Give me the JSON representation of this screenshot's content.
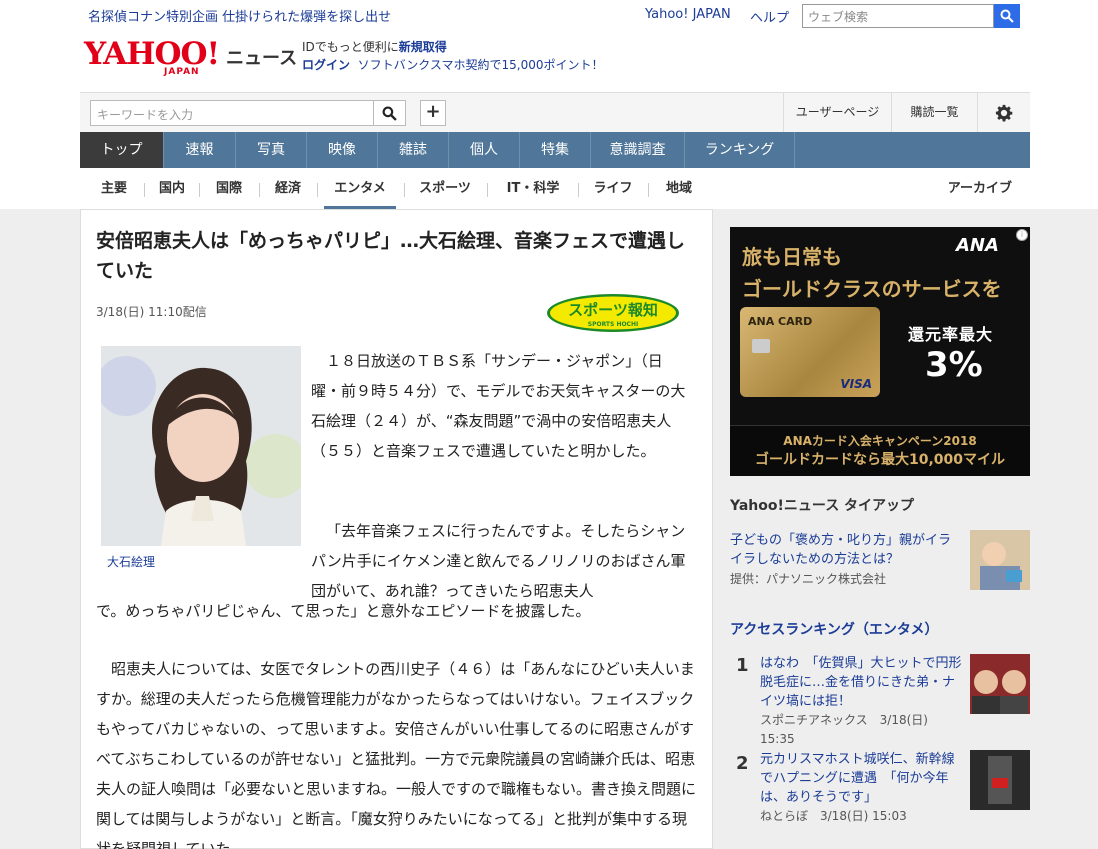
{
  "top": {
    "promo": "名探偵コナン特別企画 仕掛けられた爆弾を探し出せ",
    "yahoo_japan": "Yahoo! JAPAN",
    "help": "ヘルプ",
    "websearch_placeholder": "ウェブ検索"
  },
  "brand": {
    "logo": "YAHOO!",
    "logo_sub": "JAPAN",
    "service": "ニュース",
    "id_line1_a": "IDでもっと便利に",
    "id_line1_b": "新規取得",
    "id_line2_a": "ログイン",
    "id_line2_b": "ソフトバンクスマホ契約で15,000ポイント！"
  },
  "searchbar": {
    "placeholder": "キーワードを入力",
    "user_page": "ユーザーページ",
    "subscription": "購読一覧"
  },
  "mainnav": [
    "トップ",
    "速報",
    "写真",
    "映像",
    "雑誌",
    "個人",
    "特集",
    "意識調査",
    "ランキング"
  ],
  "subnav": [
    "主要",
    "国内",
    "国際",
    "経済",
    "エンタメ",
    "スポーツ",
    "IT・科学",
    "ライフ",
    "地域"
  ],
  "archive": "アーカイブ",
  "article": {
    "title": "安倍昭恵夫人は「めっちゃパリピ」…大石絵理、音楽フェスで遭遇していた",
    "date": "3/18(日) 11:10配信",
    "source_logo": "スポーツ報知",
    "source_logo_sub": "SPORTS HOCHI",
    "photo_caption": "大石絵理",
    "p1": "１８日放送のＴＢＳ系「サンデー・ジャポン」（日曜・前９時５４分）で、モデルでお天気キャスターの大石絵理（２４）が、“森友問題”で渦中の安倍昭恵夫人（５５）と音楽フェスで遭遇していたと明かした。",
    "p2a": "「去年音楽フェスに行ったんですよ。そしたらシャンパン片手にイケメン達と飲んでるノリノリのおばさん軍団がいて、あれ誰？ってきいたら昭恵夫人",
    "p2b": "で。めっちゃパリピじゃん、て思った」と意外なエピソードを披露した。",
    "p3": "昭恵夫人については、女医でタレントの西川史子（４６）は「あんなにひどい夫人いますか。総理の夫人だったら危機管理能力がなかったらなってはいけない。フェイスブックもやってバカじゃないの、って思いますよ。安倍さんがいい仕事してるのに昭恵さんがすべてぶちこわしているのが許せない」と猛批判。一方で元衆院議員の宮崎謙介氏は、昭恵夫人の証人喚問は「必要ないと思いますね。一般人ですので職権もない。書き換え問題に関しては関与しようがない」と断言。「魔女狩りみたいになってる」と批判が集中する現状を疑問視していた。"
  },
  "ad": {
    "line1": "旅も日常も",
    "line2": "ゴールドクラスのサービスを",
    "brand": "ANA",
    "card_name": "ANA CARD",
    "card_visa": "VISA",
    "rate_label": "還元率最大",
    "rate_value": "3%",
    "bottom1": "ANAカード入会キャンペーン2018",
    "bottom2": "ゴールドカードなら最大10,000マイル"
  },
  "tieup": {
    "heading": "Yahoo!ニュース タイアップ",
    "link": "子どもの「褒め方・叱り方」親がイライラしないための方法とは？",
    "provider": "提供：パナソニック株式会社"
  },
  "ranking": {
    "heading": "アクセスランキング（エンタメ）",
    "items": [
      {
        "num": "1",
        "title": "はなわ　「佐賀県」大ヒットで円形脱毛症に…金を借りにきた弟・ナイツ塙には拒！",
        "source": "スポニチアネックス　3/18(日) 15:35"
      },
      {
        "num": "2",
        "title": "元カリスマホスト城咲仁、新幹線でハプニングに遭遇　「何か今年は、ありそうです」",
        "source": "ねとらぼ　3/18(日) 15:03"
      }
    ]
  }
}
